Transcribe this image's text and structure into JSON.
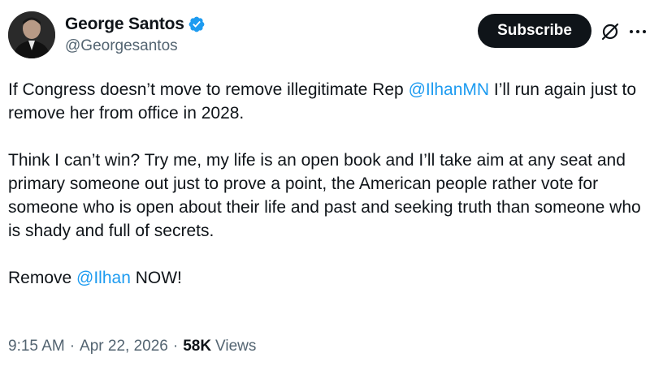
{
  "author": {
    "display_name": "George Santos",
    "handle": "@Georgesantos",
    "verified": true
  },
  "actions": {
    "subscribe_label": "Subscribe",
    "grok_icon": "grok-slash-circle-icon",
    "more_icon": "more-dots-icon"
  },
  "tweet": {
    "para1": {
      "text1": "If Congress doesn’t move to remove illegitimate Rep ",
      "mention": "@IlhanMN",
      "text2": " I’ll run again just to remove her from office in 2028."
    },
    "para2": "Think I can’t win? Try me, my life is an open book and I’ll take aim at any seat and primary someone out just to prove a point, the American people rather vote for someone who is open about their life and past and seeking truth than someone who is shady and full of secrets.",
    "para3": {
      "text1": "Remove ",
      "mention": "@Ilhan",
      "text2": " NOW!"
    }
  },
  "meta": {
    "time": "9:15 AM",
    "separator": "·",
    "date": "Apr 22, 2026",
    "views_count": "58K",
    "views_label": "Views"
  },
  "colors": {
    "link": "#1d9bf0",
    "verified_badge": "#1d9bf0",
    "text_primary": "#0f1419",
    "text_secondary": "#536471"
  }
}
